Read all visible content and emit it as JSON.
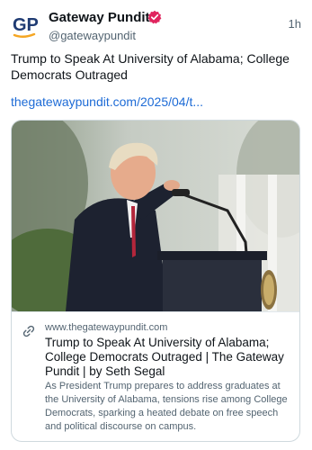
{
  "author": {
    "name": "Gateway Pundit",
    "handle": "@gatewaypundit",
    "avatar_text": "GP",
    "verified_color": "#e0245e"
  },
  "timestamp": "1h",
  "post": {
    "text": "Trump to Speak At University of Alabama; College Democrats Outraged",
    "link": "thegatewaypundit.com/2025/04/t..."
  },
  "card": {
    "domain": "www.thegatewaypundit.com",
    "title": "Trump to Speak At University of Alabama; College Democrats Outraged | The Gateway Pundit | by Seth Segal",
    "description": "As President Trump prepares to address graduates at the University of Alabama, tensions rise among College Democrats, sparking a heated debate on free speech and political discourse on campus.",
    "link_icon": "link-icon"
  },
  "colors": {
    "link": "#1d6bd6",
    "secondary_text": "#536471",
    "border": "#cfd9de",
    "avatar_blue": "#1f3b73",
    "avatar_accent": "#f5a623"
  }
}
